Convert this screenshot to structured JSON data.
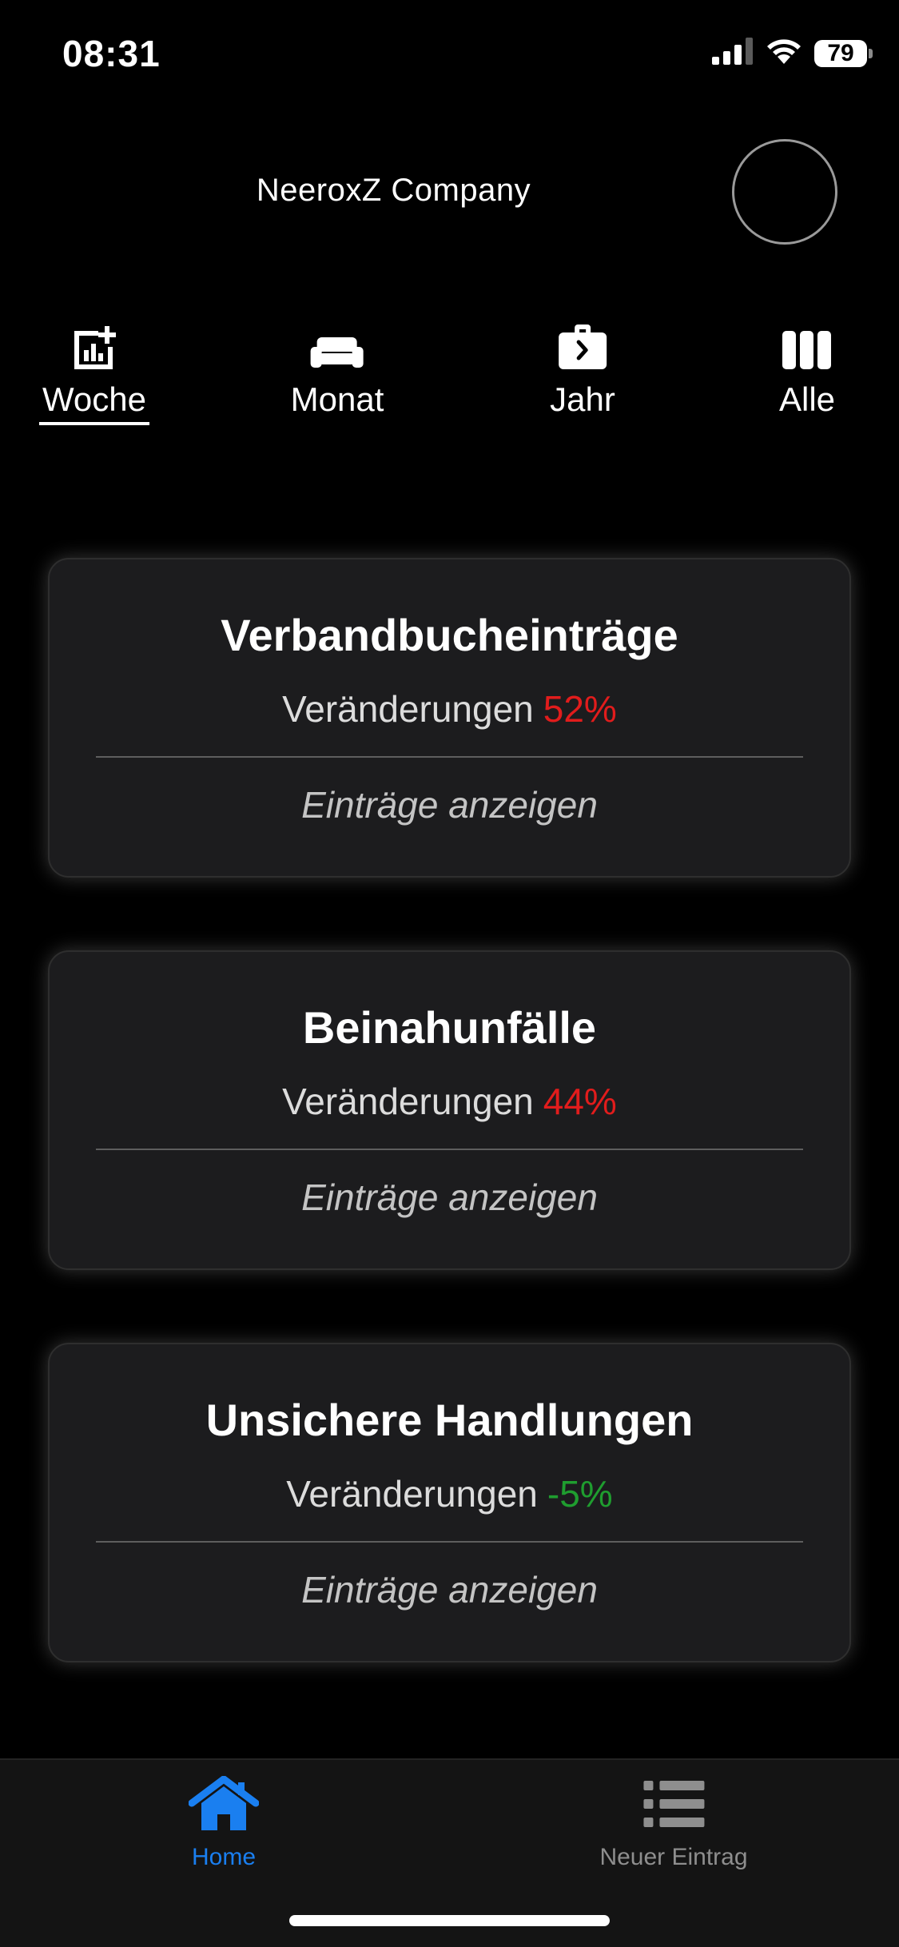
{
  "status_bar": {
    "time": "08:31",
    "battery": "79",
    "icons": [
      "cellular-signal-icon",
      "wifi-icon",
      "battery-icon"
    ]
  },
  "header": {
    "company_name": "NeeroxZ Company"
  },
  "period_tabs": [
    {
      "label": "Woche",
      "icon": "chart-add-icon",
      "active": true
    },
    {
      "label": "Monat",
      "icon": "sofa-icon",
      "active": false
    },
    {
      "label": "Jahr",
      "icon": "briefcase-icon",
      "active": false
    },
    {
      "label": "Alle",
      "icon": "columns-icon",
      "active": false
    }
  ],
  "cards": [
    {
      "title": "Verbandbucheinträge",
      "change_label": "Veränderungen",
      "change_value": "52%",
      "trend": "negative",
      "link": "Einträge anzeigen"
    },
    {
      "title": "Beinahunfälle",
      "change_label": "Veränderungen",
      "change_value": "44%",
      "trend": "negative",
      "link": "Einträge anzeigen"
    },
    {
      "title": "Unsichere Handlungen",
      "change_label": "Veränderungen",
      "change_value": "-5%",
      "trend": "positive",
      "link": "Einträge anzeigen"
    }
  ],
  "tab_bar": {
    "items": [
      {
        "label": "Home",
        "icon": "home-icon",
        "active": true
      },
      {
        "label": "Neuer Eintrag",
        "icon": "list-icon",
        "active": false
      }
    ]
  },
  "colors": {
    "accent": "#1a7ff0",
    "negative": "#e11c1c",
    "positive": "#1f9d2f",
    "inactive": "#8e8e8e"
  }
}
